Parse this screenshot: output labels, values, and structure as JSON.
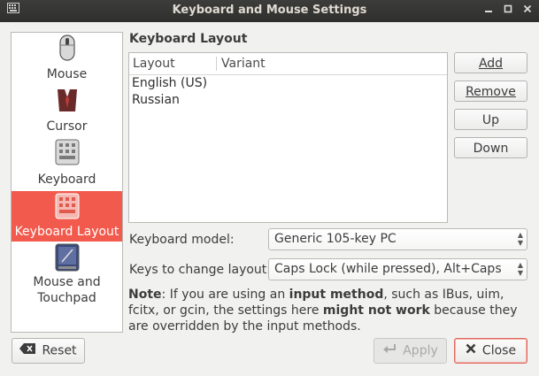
{
  "window": {
    "title": "Keyboard and Mouse Settings"
  },
  "sidebar": {
    "items": [
      {
        "label": "Mouse",
        "icon": "mouse-icon",
        "selected": false
      },
      {
        "label": "Cursor",
        "icon": "cursor-icon",
        "selected": false
      },
      {
        "label": "Keyboard",
        "icon": "keyboard-icon",
        "selected": false
      },
      {
        "label": "Keyboard Layout",
        "icon": "keyboard-layout-icon",
        "selected": true
      },
      {
        "label": "Mouse and\nTouchpad",
        "icon": "touchpad-icon",
        "selected": false
      }
    ]
  },
  "layout_section": {
    "title": "Keyboard Layout",
    "columns": [
      "Layout",
      "Variant"
    ],
    "rows": [
      {
        "layout": "English (US)",
        "variant": ""
      },
      {
        "layout": "Russian",
        "variant": ""
      }
    ],
    "buttons": {
      "add": "Add",
      "remove": "Remove",
      "up": "Up",
      "down": "Down"
    }
  },
  "options": {
    "model_label": "Keyboard model:",
    "model_value": "Generic 105-key PC",
    "switch_label": "Keys to change layout:",
    "switch_value": "Caps Lock (while pressed), Alt+Caps Lock"
  },
  "note": {
    "prefix": "Note",
    "text1": ": If you are using an ",
    "bold1": "input method",
    "text2": ", such as IBus, uim, fcitx, or gcin, the settings here ",
    "bold2": "might not work",
    "text3": " because they are overridden by the input methods."
  },
  "footer": {
    "reset": "Reset",
    "apply": "Apply",
    "close": "Close"
  },
  "colors": {
    "accent": "#f15a4c",
    "titlebar": "#3c3c3a"
  }
}
